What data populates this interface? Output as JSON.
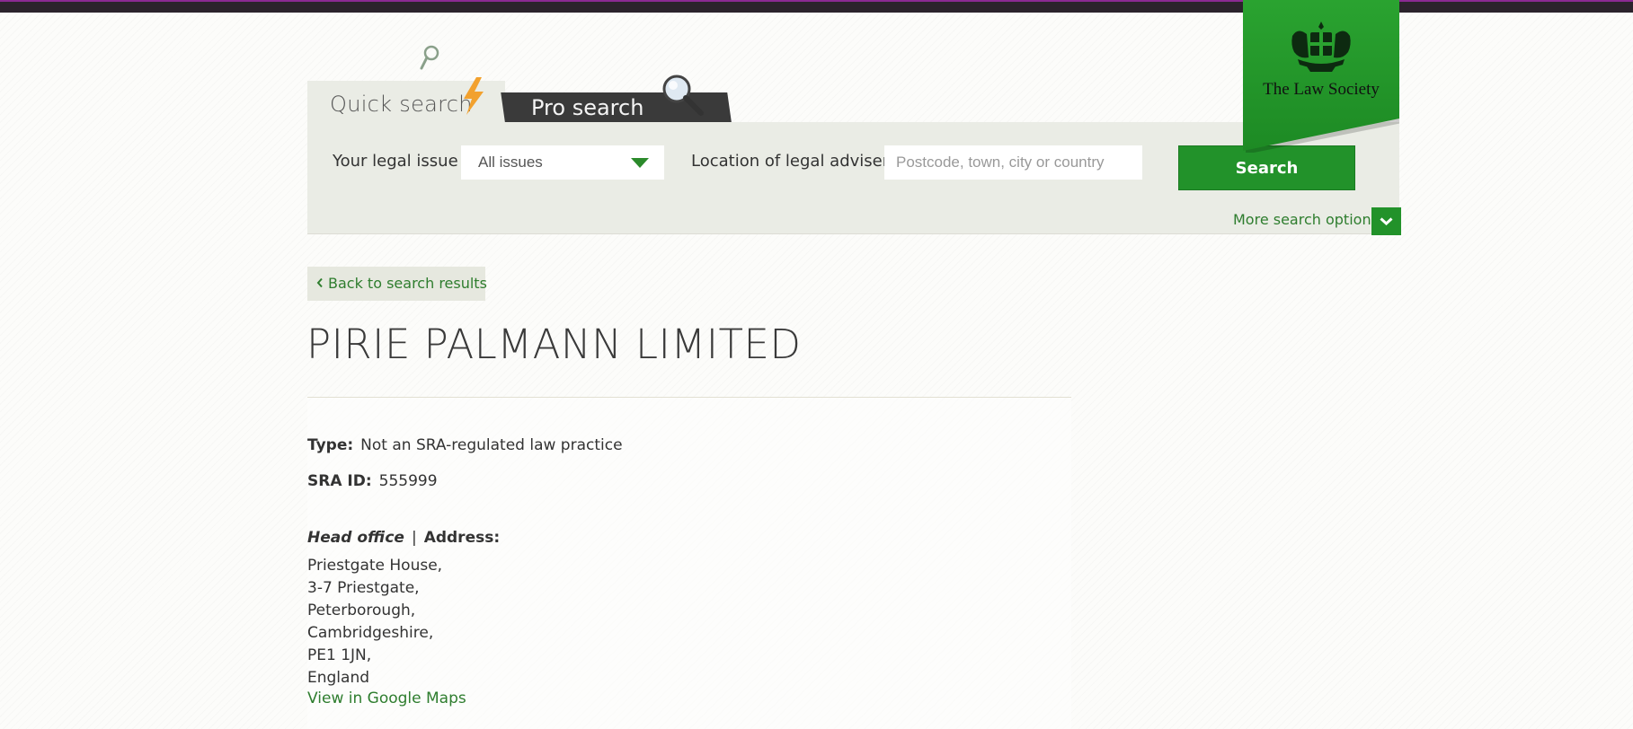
{
  "header": {
    "brand": {
      "name": "The Law Society",
      "color": "#22922a"
    }
  },
  "search": {
    "tabs": [
      {
        "label": "Quick search",
        "active": true
      },
      {
        "label": "Pro search",
        "active": false
      }
    ],
    "legal_issue_label": "Your legal issue",
    "legal_issue_value": "All issues",
    "location_label": "Location of legal adviser",
    "location_placeholder": "Postcode, town, city or country",
    "location_value": "",
    "search_button": "Search",
    "more_options": "More search options"
  },
  "nav": {
    "back_label": "Back to search results"
  },
  "firm": {
    "name": "PIRIE PALMANN LIMITED",
    "type_label": "Type:",
    "type_value": "Not an SRA-regulated law practice",
    "sra_label": "SRA ID:",
    "sra_value": "555999",
    "office_label": "Head office",
    "separator": "|",
    "address_label": "Address:",
    "address_lines": [
      "Priestgate House,",
      "3-7 Priestgate,",
      "Peterborough,",
      "Cambridgeshire,",
      "PE1 1JN,",
      "England"
    ],
    "maps_link": "View in Google Maps"
  },
  "colors": {
    "accent_green": "#22922a",
    "link_green": "#2e7d2e",
    "top_bar": "#2b232c",
    "top_bar_line": "#8b2a93",
    "pro_tab": "#3a3a3a"
  },
  "icons": [
    "magnifier-icon",
    "lightning-bolt-icon",
    "chevron-down-icon",
    "chevron-left-icon",
    "crest-icon"
  ]
}
